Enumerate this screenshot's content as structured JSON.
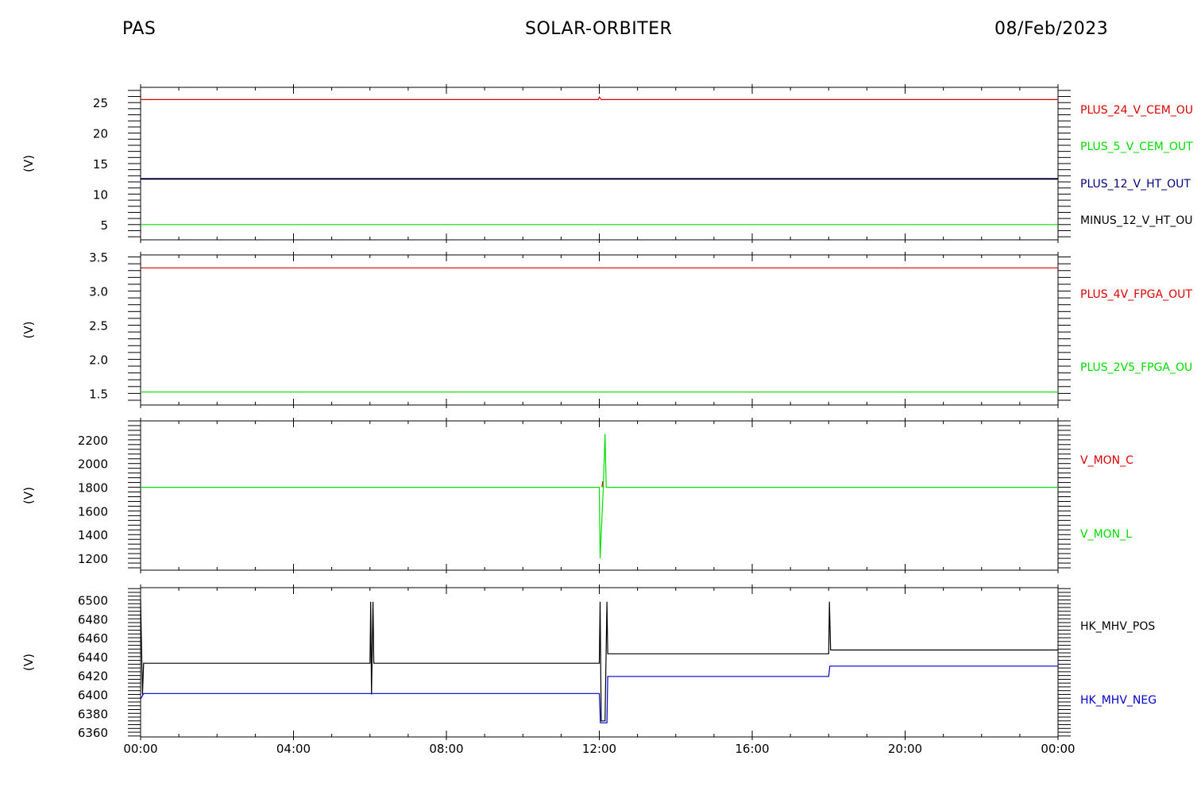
{
  "header": {
    "left": "PAS",
    "center": "SOLAR-ORBITER",
    "right": "08/Feb/2023"
  },
  "chart_data": [
    {
      "type": "line",
      "ylabel": "(V)",
      "ylim": [
        2.5,
        27.5
      ],
      "yticks": [
        5,
        10,
        15,
        20,
        25
      ],
      "ytick_labels": [
        "5",
        "10",
        "15",
        "20",
        "25"
      ],
      "x": [
        "00:00",
        "24:00"
      ],
      "series": [
        {
          "name": "PLUS_24_V_CEM_OUT",
          "label_shown": "PLUS_24_V_CEM_OU",
          "color": "#dd0000",
          "values": [
            25.5,
            25.5
          ],
          "blip": {
            "at": "12:00",
            "value": 25.9
          }
        },
        {
          "name": "PLUS_5_V_CEM_OUT",
          "label_shown": "PLUS_5_V_CEM_OUT",
          "color": "#00dd00",
          "values": [
            5.0,
            5.0
          ]
        },
        {
          "name": "PLUS_12_V_HT_OUT",
          "label_shown": "PLUS_12_V_HT_OUT",
          "color": "#000080",
          "values": [
            12.5,
            12.5
          ]
        },
        {
          "name": "MINUS_12_V_HT_OUT",
          "label_shown": "MINUS_12_V_HT_OU",
          "color": "#000000",
          "values": [
            12.5,
            12.5
          ]
        }
      ]
    },
    {
      "type": "line",
      "ylabel": "(V)",
      "ylim": [
        1.33,
        3.53
      ],
      "yticks": [
        1.5,
        2.0,
        2.5,
        3.0,
        3.5
      ],
      "ytick_labels": [
        "1.5",
        "2.0",
        "2.5",
        "3.0",
        "3.5"
      ],
      "x": [
        "00:00",
        "24:00"
      ],
      "series": [
        {
          "name": "PLUS_4V_FPGA_OUT",
          "label_shown": "PLUS_4V_FPGA_OUT",
          "color": "#dd0000",
          "values": [
            3.34,
            3.34
          ]
        },
        {
          "name": "PLUS_2V5_FPGA_OUT",
          "label_shown": "PLUS_2V5_FPGA_OU",
          "color": "#00dd00",
          "values": [
            1.52,
            1.52
          ]
        }
      ]
    },
    {
      "type": "line",
      "ylabel": "(V)",
      "ylim": [
        1100,
        2360
      ],
      "yticks": [
        1200,
        1400,
        1600,
        1800,
        2000,
        2200
      ],
      "ytick_labels": [
        "1200",
        "1400",
        "1600",
        "1800",
        "2000",
        "2200"
      ],
      "series": [
        {
          "name": "V_MON_C",
          "label_shown": "V_MON_C",
          "color": "#dd0000",
          "points": [
            [
              12.07,
              1800
            ],
            [
              12.09,
              1850
            ],
            [
              12.11,
              1800
            ]
          ]
        },
        {
          "name": "V_MON_L",
          "label_shown": "V_MON_L",
          "color": "#00dd00",
          "points": [
            [
              0,
              1800
            ],
            [
              12.0,
              1800
            ],
            [
              12.02,
              1200
            ],
            [
              12.1,
              1760
            ],
            [
              12.15,
              2250
            ],
            [
              12.18,
              1800
            ],
            [
              24,
              1800
            ]
          ]
        }
      ]
    },
    {
      "type": "line",
      "ylabel": "(V)",
      "ylim": [
        6355,
        6513
      ],
      "yticks": [
        6360,
        6380,
        6400,
        6420,
        6440,
        6460,
        6480,
        6500
      ],
      "ytick_labels": [
        "6360",
        "6380",
        "6400",
        "6420",
        "6440",
        "6460",
        "6480",
        "6500"
      ],
      "series": [
        {
          "name": "HK_MHV_POS",
          "label_shown": "HK_MHV_POS",
          "color": "#000000",
          "points": [
            [
              0,
              6500
            ],
            [
              0.05,
              6400
            ],
            [
              0.08,
              6433
            ],
            [
              6.0,
              6433
            ],
            [
              6.02,
              6498
            ],
            [
              6.04,
              6400
            ],
            [
              6.08,
              6498
            ],
            [
              6.1,
              6433
            ],
            [
              12.0,
              6433
            ],
            [
              12.02,
              6498
            ],
            [
              12.05,
              6372
            ],
            [
              12.15,
              6372
            ],
            [
              12.2,
              6498
            ],
            [
              12.22,
              6443
            ],
            [
              18.0,
              6443
            ],
            [
              18.02,
              6498
            ],
            [
              18.05,
              6447
            ],
            [
              24,
              6447
            ]
          ]
        },
        {
          "name": "HK_MHV_NEG",
          "label_shown": "HK_MHV_NEG",
          "color": "#0000cc",
          "points": [
            [
              0,
              6395
            ],
            [
              0.08,
              6401
            ],
            [
              12.0,
              6401
            ],
            [
              12.03,
              6370
            ],
            [
              12.2,
              6370
            ],
            [
              12.22,
              6419
            ],
            [
              18.0,
              6419
            ],
            [
              18.03,
              6430
            ],
            [
              24,
              6430
            ]
          ]
        }
      ]
    }
  ],
  "x_axis": {
    "ticks": [
      "00:00",
      "04:00",
      "08:00",
      "12:00",
      "16:00",
      "20:00",
      "00:00"
    ]
  }
}
